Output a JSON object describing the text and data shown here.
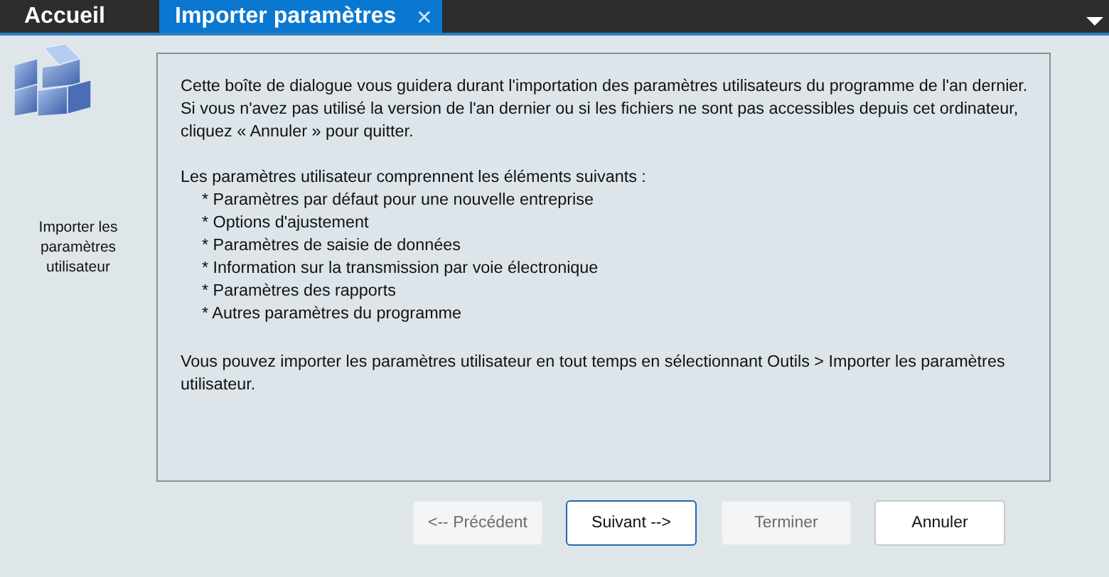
{
  "tabs": [
    {
      "label": "Accueil",
      "selected": false
    },
    {
      "label": "Importer paramètres",
      "selected": true,
      "close": "✕"
    }
  ],
  "sidebar": {
    "caption": "Importer les paramètres utilisateur"
  },
  "dialog": {
    "intro": "Cette boîte de dialogue vous guidera durant l'importation des paramètres utilisateurs du programme de l'an dernier. Si vous n'avez pas utilisé la version de l'an dernier ou si les fichiers ne sont pas accessibles depuis cet ordinateur, cliquez « Annuler » pour quitter.",
    "list_heading": "Les paramètres utilisateur comprennent les éléments suivants :",
    "items": [
      "* Paramètres par défaut pour une nouvelle entreprise",
      "* Options d'ajustement",
      "* Paramètres de saisie de données",
      "* Information sur la transmission par voie électronique",
      "* Paramètres des rapports",
      "* Autres paramètres du programme"
    ],
    "footer": "Vous pouvez importer les paramètres utilisateur en tout temps en sélectionnant Outils > Importer les paramètres utilisateur."
  },
  "buttons": [
    {
      "label": "<-- Précédent",
      "disabled": true,
      "focused": false
    },
    {
      "label": "Suivant -->",
      "disabled": false,
      "focused": true
    },
    {
      "label": "Terminer",
      "disabled": true,
      "focused": false
    },
    {
      "label": "Annuler",
      "disabled": false,
      "focused": false
    }
  ]
}
